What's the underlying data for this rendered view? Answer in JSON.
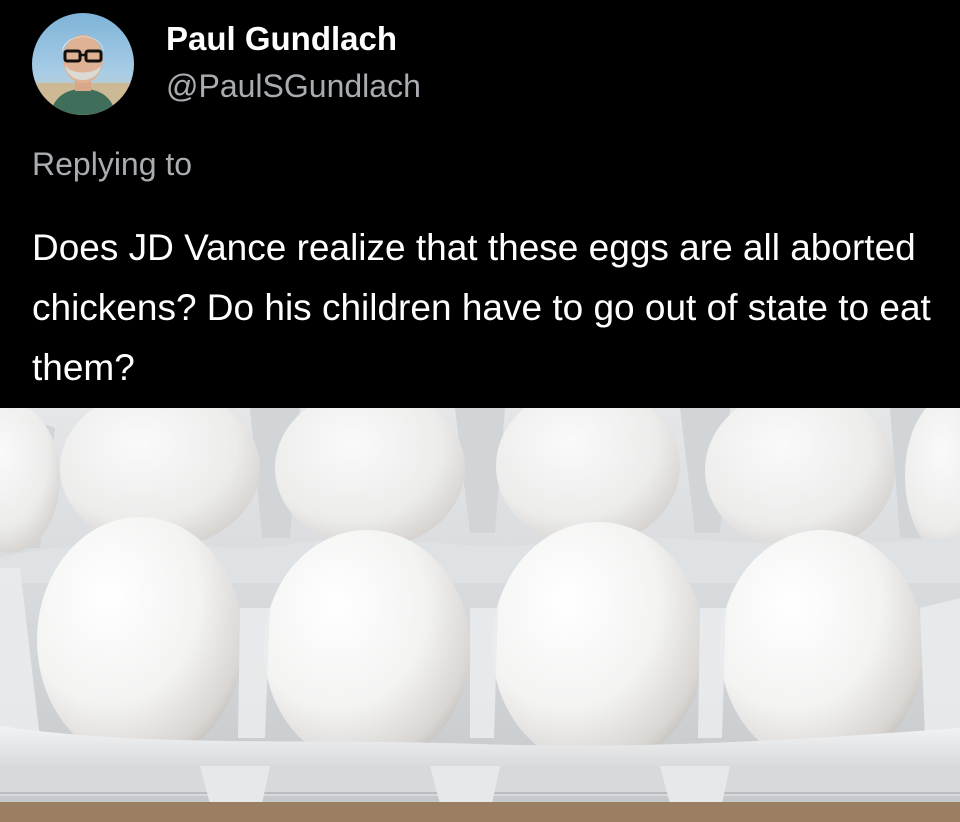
{
  "tweet": {
    "author": {
      "display_name": "Paul Gundlach",
      "handle": "@PaulSGundlach",
      "avatar_icon": "profile-photo"
    },
    "replying_to_label": "Replying to",
    "text": "Does JD Vance realize that these eggs are all aborted chickens? Do his children have to go out of state to eat them?",
    "media": {
      "type": "photo",
      "icon": "egg-carton-photo"
    }
  },
  "colors": {
    "background": "#000000",
    "primary_text": "#ffffff",
    "secondary_text": "#a9adb1"
  }
}
